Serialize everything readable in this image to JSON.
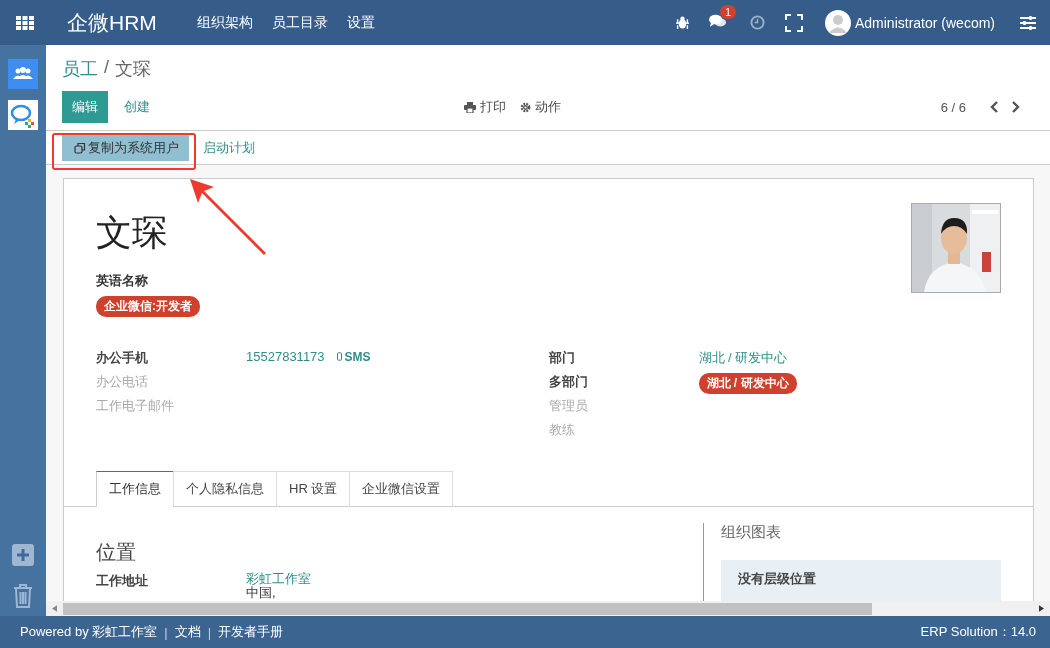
{
  "navbar": {
    "brand": "企微HRM",
    "menu": [
      "组织架构",
      "员工目录",
      "设置"
    ],
    "chat_badge": "1",
    "user": "Administrator (wecom)"
  },
  "breadcrumb": {
    "parent": "员工",
    "separator": "/",
    "current": "文琛"
  },
  "actions": {
    "edit": "编辑",
    "create": "创建",
    "print": "打印",
    "action": "动作",
    "pager": "6 / 6"
  },
  "header_buttons": [
    {
      "label": "复制为系统用户",
      "kind": "primary"
    },
    {
      "label": "启动计划",
      "kind": "link"
    }
  ],
  "employee": {
    "name": "文琛",
    "english_name_label": "英语名称",
    "tag": {
      "label": "企业微信:开发者",
      "color": "#d0412d"
    }
  },
  "left_fields": [
    {
      "label": "办公手机",
      "value": "15527831173",
      "sms": "SMS",
      "empty": false
    },
    {
      "label": "办公电话",
      "empty": true
    },
    {
      "label": "工作电子邮件",
      "empty": true
    }
  ],
  "right_fields": [
    {
      "label": "部门",
      "kind": "link",
      "value": "湖北 / 研发中心",
      "empty": false
    },
    {
      "label": "多部门",
      "kind": "tag",
      "value": "湖北 / 研发中心",
      "color": "#d0412d",
      "empty": false
    },
    {
      "label": "管理员",
      "empty": true
    },
    {
      "label": "教练",
      "empty": true
    }
  ],
  "tabs": [
    {
      "label": "工作信息",
      "selected": true
    },
    {
      "label": "个人隐私信息",
      "selected": false
    },
    {
      "label": "HR 设置",
      "selected": false
    },
    {
      "label": "企业微信设置",
      "selected": false
    }
  ],
  "location": {
    "title": "位置",
    "label": "工作地址",
    "value": [
      "彩虹工作室",
      "中国,"
    ]
  },
  "org_chart": {
    "title": "组织图表",
    "box_title": "没有层级位置"
  },
  "footer": {
    "powered": "Powered by 彩虹工作室",
    "links": [
      {
        "separator": "|",
        "label": "文档"
      },
      {
        "separator": "|",
        "label": "开发者手册"
      }
    ],
    "version": "ERP Solution：14.0"
  }
}
